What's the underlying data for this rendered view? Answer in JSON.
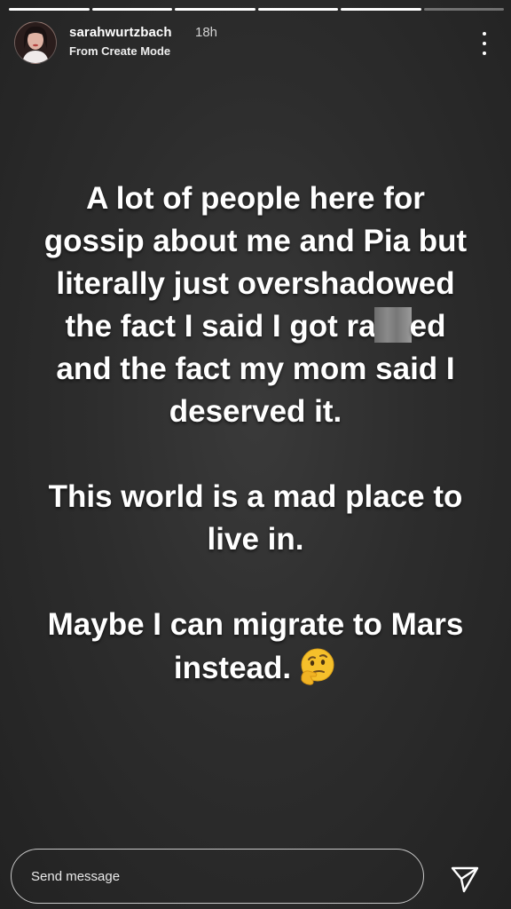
{
  "story": {
    "progress": [
      1,
      1,
      1,
      1,
      1,
      0
    ]
  },
  "header": {
    "username": "sarahwurtzbach",
    "time": "18h",
    "subtitle": "From Create Mode",
    "avatar_icon": "profile-photo",
    "more_icon": "more-vertical-icon"
  },
  "content": {
    "para1_before_censor": "A lot of people here for gossip about me and Pia but literally just overshadowed the fact I said I got ra",
    "para1_after_censor": "ed and the fact my mom said I deserved it.",
    "para2": "This world is a mad place to live in.",
    "para3": "Maybe I can migrate to Mars instead.",
    "emoji_icon": "thinking-face-icon"
  },
  "footer": {
    "message_placeholder": "Send message",
    "send_icon": "paper-plane-icon"
  },
  "colors": {
    "background": "#2d2d2d",
    "text": "#ffffff",
    "emoji": "#f5c02b"
  }
}
